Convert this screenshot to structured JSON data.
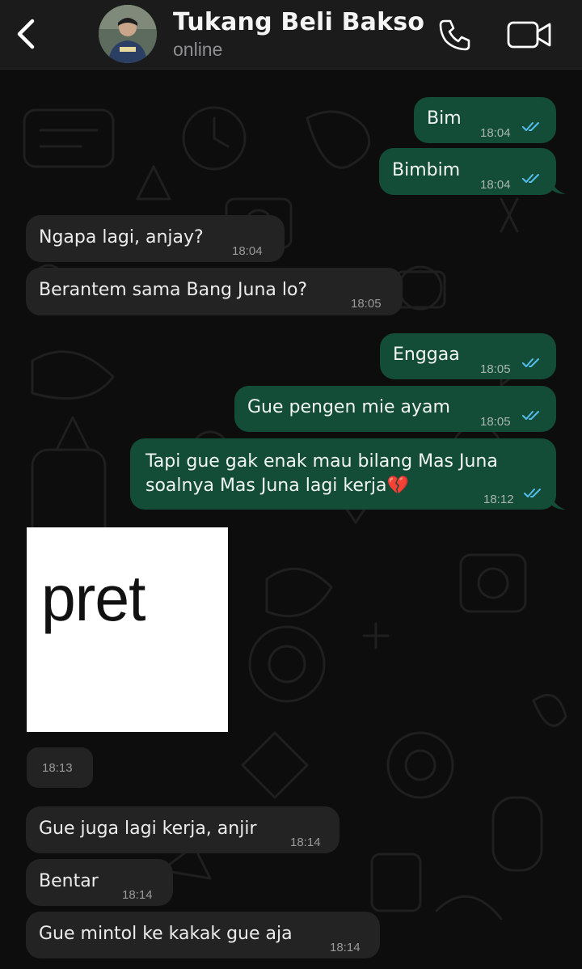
{
  "header": {
    "contact_name": "Tukang Beli Bakso",
    "status": "online",
    "icons": {
      "back": "chevron-left-icon",
      "call": "phone-icon",
      "video": "video-camera-icon"
    }
  },
  "theme": {
    "outgoing_bubble": "#144d37",
    "incoming_bubble": "#232323",
    "read_ticks": "#53bdeb"
  },
  "messages": [
    {
      "direction": "out",
      "text": "Bim",
      "time": "18:04",
      "read": true
    },
    {
      "direction": "out",
      "text": "Bimbim",
      "time": "18:04",
      "read": true
    },
    {
      "direction": "in",
      "text": "Ngapa lagi, anjay?",
      "time": "18:04"
    },
    {
      "direction": "in",
      "text": "Berantem sama Bang Juna lo?",
      "time": "18:05"
    },
    {
      "direction": "out",
      "text": "Enggaa",
      "time": "18:05",
      "read": true
    },
    {
      "direction": "out",
      "text": "Gue pengen mie ayam",
      "time": "18:05",
      "read": true
    },
    {
      "direction": "out",
      "lines": [
        "Tapi gue gak enak mau bilang Mas Juna",
        "soalnya Mas Juna lagi kerja💔"
      ],
      "time": "18:12",
      "read": true
    },
    {
      "direction": "in",
      "type": "image",
      "image_text": "pret",
      "time": "18:13"
    },
    {
      "direction": "in",
      "text": "Gue juga lagi kerja, anjir",
      "time": "18:14"
    },
    {
      "direction": "in",
      "text": "Bentar",
      "time": "18:14"
    },
    {
      "direction": "in",
      "text": "Gue mintol ke kakak gue aja",
      "time": "18:14"
    }
  ]
}
